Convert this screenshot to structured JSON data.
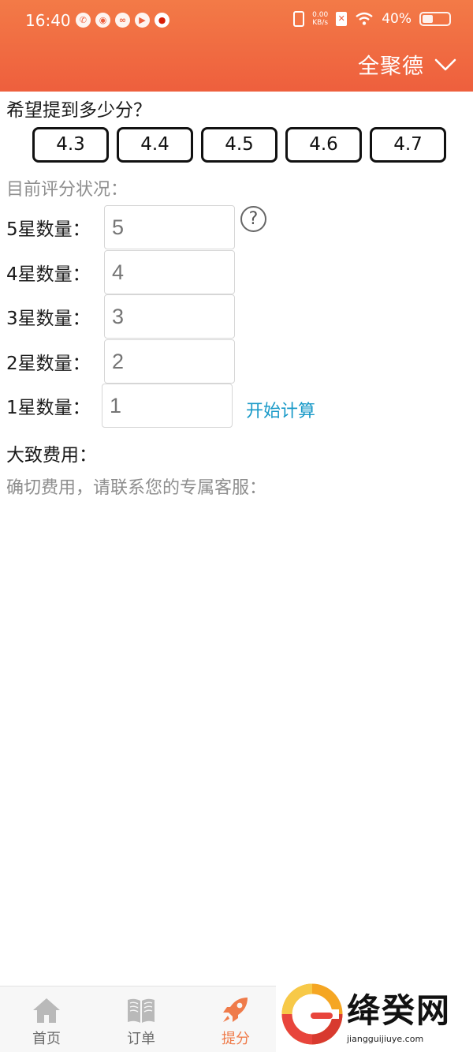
{
  "status_bar": {
    "time": "16:40",
    "net_speed_value": "0.00",
    "net_speed_unit": "KB/s",
    "battery": "40%",
    "battery_level": 0.4
  },
  "header": {
    "store_name": "全聚德",
    "color_top": "#f37a47",
    "color_bottom": "#ee5f3d"
  },
  "target": {
    "question": "希望提到多少分？",
    "options": [
      "4.3",
      "4.4",
      "4.5",
      "4.6",
      "4.7"
    ]
  },
  "current": {
    "title": "目前评分状况：",
    "rows": [
      {
        "label": "5星数量：",
        "placeholder": "5"
      },
      {
        "label": "4星数量：",
        "placeholder": "4"
      },
      {
        "label": "3星数量：",
        "placeholder": "3"
      },
      {
        "label": "2星数量：",
        "placeholder": "2"
      },
      {
        "label": "1星数量：",
        "placeholder": "1"
      }
    ],
    "help_glyph": "?",
    "calc_label": "开始计算"
  },
  "fee": {
    "label": "大致费用：",
    "contact_note": "确切费用，请联系您的专属客服："
  },
  "bottom_nav": {
    "items": [
      {
        "label": "首页",
        "icon": "home-icon"
      },
      {
        "label": "订单",
        "icon": "book-icon"
      },
      {
        "label": "提分",
        "icon": "rocket-icon",
        "active": true
      }
    ],
    "active_color": "#ef7b4a"
  },
  "watermark": {
    "title": "绛癸网",
    "url": "jiangguijiuye.com"
  }
}
